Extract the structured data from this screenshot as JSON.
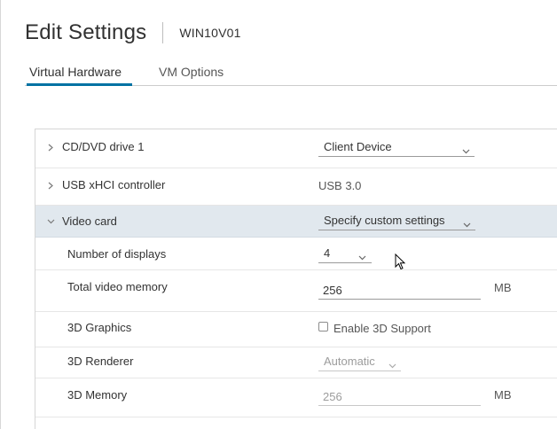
{
  "header": {
    "title": "Edit Settings",
    "vm_name": "WIN10V01"
  },
  "tabs": [
    {
      "label": "Virtual Hardware",
      "active": true
    },
    {
      "label": "VM Options",
      "active": false
    }
  ],
  "rows": {
    "cd_drive": {
      "label": "CD/DVD drive 1",
      "value": "Client Device"
    },
    "usb": {
      "label": "USB xHCI controller",
      "value": "USB 3.0"
    },
    "video_card": {
      "label": "Video card",
      "value": "Specify custom settings",
      "expanded": true
    },
    "num_displays": {
      "label": "Number of displays",
      "value": "4"
    },
    "video_memory": {
      "label": "Total video memory",
      "value": "256",
      "unit": "MB"
    },
    "graphics_3d": {
      "label": "3D Graphics",
      "checkbox_label": "Enable 3D Support",
      "checked": false
    },
    "renderer_3d": {
      "label": "3D Renderer",
      "value": "Automatic",
      "disabled": true
    },
    "memory_3d": {
      "label": "3D Memory",
      "value": "256",
      "unit": "MB",
      "disabled": true
    }
  },
  "colors": {
    "accent": "#0072a3",
    "selected_row": "#e1e8ee"
  }
}
